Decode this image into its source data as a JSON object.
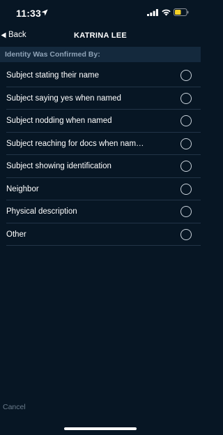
{
  "status_bar": {
    "time": "11:33",
    "icons": [
      "location-arrow-icon",
      "cellular-signal-icon",
      "wifi-icon",
      "battery-icon"
    ],
    "battery_color": "#f5d228"
  },
  "nav": {
    "back_label": "Back",
    "back_icon": "triangle-left-icon",
    "title": "KATRINA LEE"
  },
  "section": {
    "header": "Identity Was Confirmed By:"
  },
  "options": [
    {
      "label": "Subject stating their name",
      "selected": false
    },
    {
      "label": "Subject saying yes when named",
      "selected": false
    },
    {
      "label": "Subject nodding when named",
      "selected": false
    },
    {
      "label": "Subject reaching for docs when nam…",
      "selected": false
    },
    {
      "label": "Subject showing identification",
      "selected": false
    },
    {
      "label": "Neighbor",
      "selected": false
    },
    {
      "label": "Physical description",
      "selected": false
    },
    {
      "label": "Other",
      "selected": false
    }
  ],
  "footer": {
    "cancel_label": "Cancel"
  },
  "colors": {
    "background": "#071624",
    "section_header_bg": "#14293d",
    "section_header_text": "#8ea2b6",
    "divider": "#223447",
    "cancel_text": "#6b7c8c"
  }
}
